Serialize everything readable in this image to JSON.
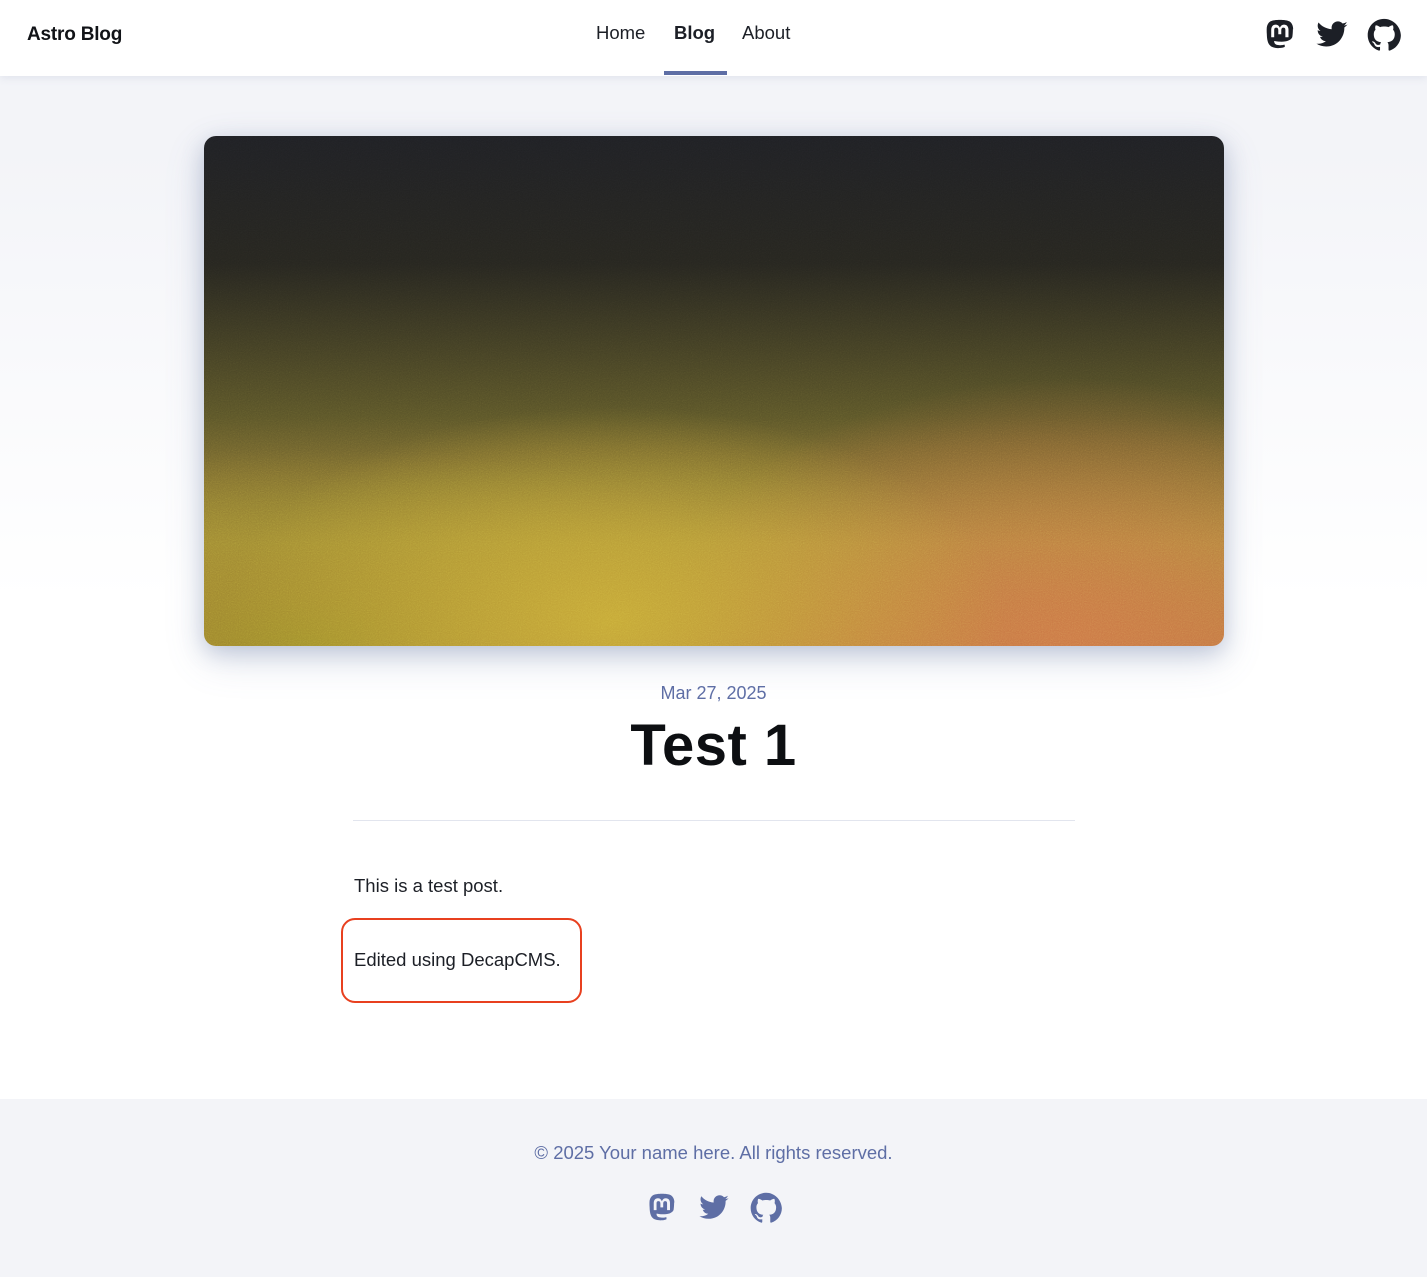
{
  "header": {
    "brand": "Astro Blog",
    "nav": [
      {
        "label": "Home"
      },
      {
        "label": "Blog"
      },
      {
        "label": "About"
      }
    ],
    "active_nav": "Blog",
    "social_icons": [
      "mastodon-icon",
      "twitter-icon",
      "github-icon"
    ]
  },
  "post": {
    "date": "Mar 27, 2025",
    "title": "Test 1",
    "paragraphs": [
      "This is a test post.",
      "Edited using DecapCMS."
    ],
    "highlight_color": "#e8401f"
  },
  "footer": {
    "copyright": "© 2025 Your name here. All rights reserved.",
    "social_icons": [
      "mastodon-icon",
      "twitter-icon",
      "github-icon"
    ]
  },
  "colors": {
    "accent": "#5e6ea5",
    "text": "#1c1f26",
    "background": "#f3f4f8"
  }
}
